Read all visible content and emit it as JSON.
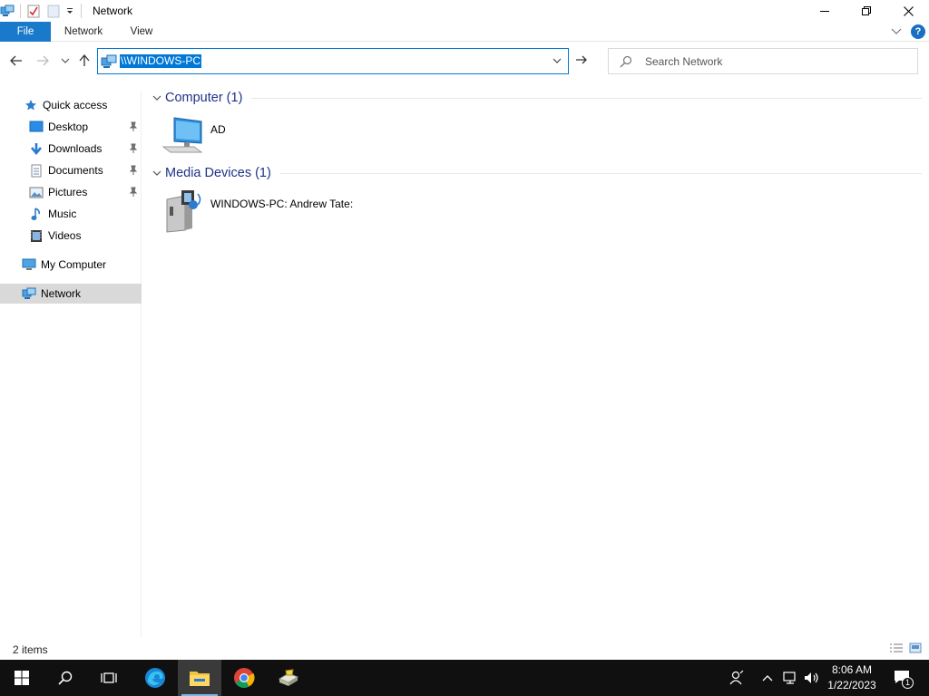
{
  "window": {
    "title": "Network",
    "quick_access_toolbar": [
      "network-icon",
      "properties-icon",
      "new-folder-icon",
      "customize-dropdown-icon"
    ],
    "controls": [
      "minimize-icon",
      "restore-icon",
      "close-icon"
    ]
  },
  "ribbon": {
    "tabs": [
      {
        "label": "File"
      },
      {
        "label": "Network"
      },
      {
        "label": "View"
      }
    ],
    "accent": "#1979ca"
  },
  "nav": {
    "address": "\\\\WINDOWS-PC",
    "search_placeholder": "Search Network"
  },
  "sidebar": {
    "items": [
      {
        "label": "Quick access",
        "icon": "star-icon"
      },
      {
        "label": "Desktop",
        "icon": "desktop-icon",
        "pinned": true
      },
      {
        "label": "Downloads",
        "icon": "download-icon",
        "pinned": true
      },
      {
        "label": "Documents",
        "icon": "documents-icon",
        "pinned": true
      },
      {
        "label": "Pictures",
        "icon": "pictures-icon",
        "pinned": true
      },
      {
        "label": "Music",
        "icon": "music-icon"
      },
      {
        "label": "Videos",
        "icon": "videos-icon"
      },
      {
        "label": "My Computer",
        "icon": "computer-icon"
      },
      {
        "label": "Network",
        "icon": "network-icon",
        "selected": true
      }
    ]
  },
  "main": {
    "groups": [
      {
        "title": "Computer",
        "count": "(1)",
        "items": [
          {
            "label": "AD",
            "icon": "computer-icon"
          }
        ]
      },
      {
        "title": "Media Devices",
        "count": "(1)",
        "items": [
          {
            "label": "WINDOWS-PC: Andrew Tate:",
            "icon": "media-server-icon"
          }
        ]
      }
    ]
  },
  "status": {
    "item_count": "2 items"
  },
  "taskbar": {
    "apps": [
      "windows-start-icon",
      "search-icon",
      "task-view-icon",
      "edge-icon",
      "file-explorer-icon",
      "chrome-icon",
      "app-icon"
    ],
    "active_app": "file-explorer-icon",
    "time": "8:06 AM",
    "date": "1/22/2023",
    "notification_count": "1"
  }
}
